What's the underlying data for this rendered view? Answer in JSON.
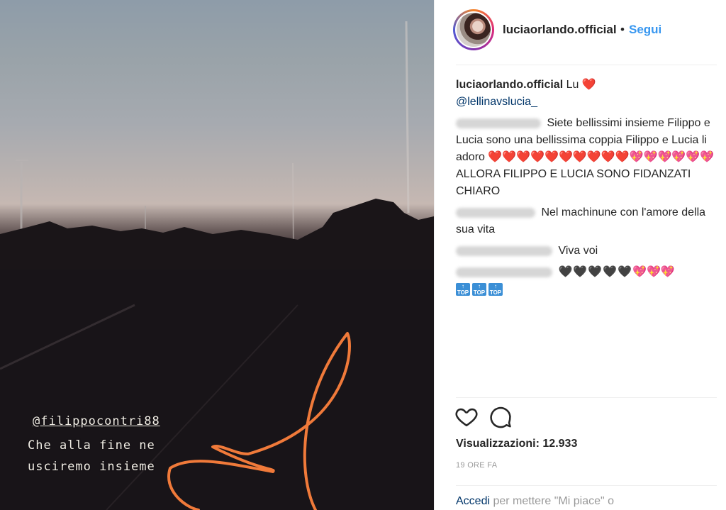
{
  "media": {
    "overlay_mention": "@filippocontri88",
    "caption_line1": "Che alla fine ne",
    "caption_line2": "usciremo insieme"
  },
  "header": {
    "username": "luciaorlando.official",
    "dot": "•",
    "follow_label": "Segui"
  },
  "caption": {
    "username": "luciaorlando.official",
    "text": "Lu",
    "heart": "❤️",
    "mention": "@lellinavslucia_"
  },
  "comments": [
    {
      "user_hidden": true,
      "text": "Siete bellissimi insieme Filippo e Lucia sono una bellissima coppia Filippo e Lucia li adoro"
    },
    {
      "user_hidden": true,
      "text": "Nel machinune con l'amore della sua vita"
    },
    {
      "user_hidden": true,
      "text": "Viva voi"
    },
    {
      "user_hidden": true,
      "text": ""
    }
  ],
  "comment1_tail": "ALLORA FILIPPO E LUCIA SONO FIDANZATI CHIARO",
  "hearts": {
    "red": "❤️",
    "sparkle": "💖",
    "black": "🖤"
  },
  "top_badge": "TOP",
  "footer": {
    "views_label": "Visualizzazioni: 12.933",
    "time": "19 ORE FA",
    "login_link": "Accedi",
    "login_rest": " per mettere \"Mi piace\" o"
  },
  "icons": {
    "like": "heart-outline-icon",
    "comment": "speech-bubble-icon"
  },
  "colors": {
    "link_blue": "#3897f0",
    "dark_link": "#003569",
    "heart_red": "#e0112b",
    "annotation_orange": "#f07a3a"
  }
}
